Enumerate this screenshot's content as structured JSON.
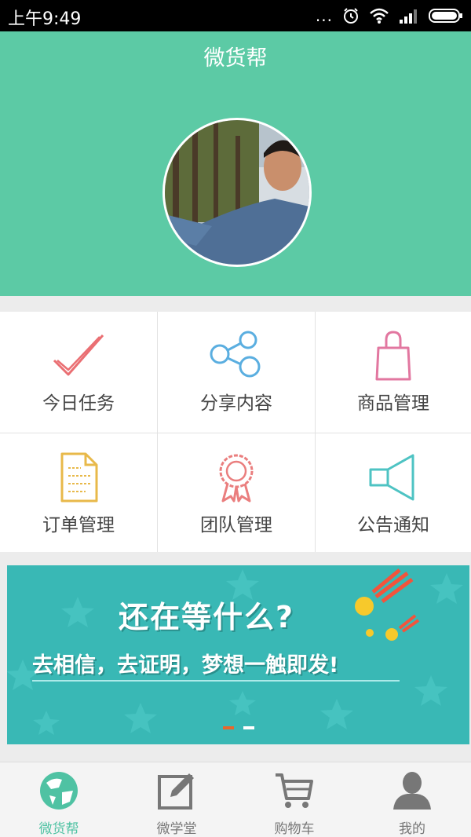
{
  "statusbar": {
    "time": "上午9:49",
    "more": "..."
  },
  "header": {
    "title": "微货帮"
  },
  "grid": {
    "items": [
      {
        "label": "今日任务",
        "icon": "checkmark-icon"
      },
      {
        "label": "分享内容",
        "icon": "share-icon"
      },
      {
        "label": "商品管理",
        "icon": "shopping-bag-icon"
      },
      {
        "label": "订单管理",
        "icon": "document-icon"
      },
      {
        "label": "团队管理",
        "icon": "award-badge-icon"
      },
      {
        "label": "公告通知",
        "icon": "megaphone-icon"
      }
    ]
  },
  "banner": {
    "line1": "还在等什么?",
    "line2": "去相信，去证明，梦想一触即发!",
    "page_count": 2,
    "active_page": 1
  },
  "tabbar": {
    "items": [
      {
        "label": "微货帮",
        "icon": "globe-icon",
        "active": true
      },
      {
        "label": "微学堂",
        "icon": "edit-icon",
        "active": false
      },
      {
        "label": "购物车",
        "icon": "cart-icon",
        "active": false
      },
      {
        "label": "我的",
        "icon": "user-icon",
        "active": false
      }
    ]
  },
  "colors": {
    "primary": "#5ccaa5",
    "banner": "#39b8b5",
    "active_tab": "#4fc2a3",
    "check": "#ea6f73",
    "share": "#5aaee0",
    "bag": "#e277a0",
    "doc": "#e8b94a",
    "badge": "#ea7e7e",
    "megaphone": "#4ec3c3"
  }
}
